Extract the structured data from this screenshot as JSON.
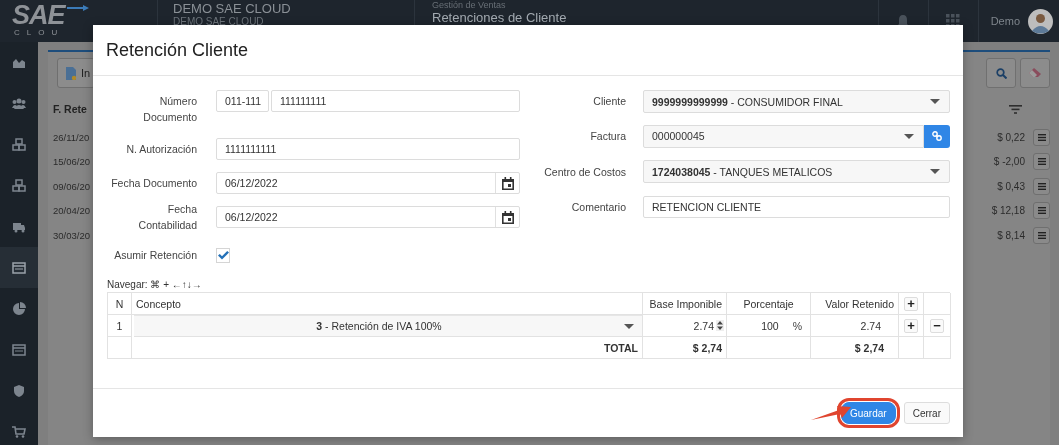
{
  "topbar": {
    "logo": "SAE",
    "logo_sub": "CLOU",
    "company": "DEMO SAE CLOUD",
    "company_sub": "DEMO SAE CLOUD",
    "module": "Gestión de Ventas",
    "page_title": "Retenciones de Cliente",
    "user": "Demo"
  },
  "sidebar": {
    "items": [
      {
        "selected": false
      },
      {
        "selected": false
      },
      {
        "selected": false
      },
      {
        "selected": false
      },
      {
        "selected": false
      },
      {
        "selected": true
      },
      {
        "selected": false
      },
      {
        "selected": false
      },
      {
        "selected": false
      },
      {
        "selected": false
      }
    ]
  },
  "list": {
    "toolbar_button": "In",
    "column_1": "F. Rete",
    "rows": [
      {
        "date": "26/11/20",
        "amount": "$ 0,22"
      },
      {
        "date": "15/06/20",
        "amount": "$ -2,00"
      },
      {
        "date": "09/06/20",
        "amount": "$ 0,43"
      },
      {
        "date": "20/04/20",
        "amount": "$ 12,18"
      },
      {
        "date": "30/03/20",
        "amount": "$ 8,14"
      }
    ]
  },
  "modal": {
    "title": "Retención Cliente",
    "left_fields": [
      {
        "kind": "pair",
        "label": "Número Documento",
        "prefix": "011-111",
        "value": "111111111"
      },
      {
        "kind": "text",
        "label": "N. Autorización",
        "value": "1111111111"
      },
      {
        "kind": "date",
        "label": "Fecha Documento",
        "value": "06/12/2022"
      },
      {
        "kind": "date",
        "label": "Fecha Contabilidad",
        "value": "06/12/2022"
      },
      {
        "kind": "checkbox",
        "label": "Asumir Retención",
        "checked": true
      }
    ],
    "right_fields": [
      {
        "kind": "select",
        "label": "Cliente",
        "value": "**9999999999999** - CONSUMIDOR FINAL"
      },
      {
        "kind": "select_link",
        "label": "Factura",
        "value": "000000045"
      },
      {
        "kind": "select",
        "label": "Centro de Costos",
        "value": "**1724038045** - TANQUES METALICOS"
      },
      {
        "kind": "text",
        "label": "Comentario",
        "value": "RETENCION CLIENTE"
      }
    ],
    "nav_hint": "Navegar: ⌘ + ←↑↓→",
    "table": {
      "columns": [
        "N",
        "Concepto",
        "Base Imponible",
        "Porcentaje",
        "Valor Retenido"
      ],
      "add_button": "+",
      "rows": [
        {
          "n": "1",
          "concepto": "**3** - Retención de IVA 100%",
          "base": "2.74",
          "porcentaje": "100",
          "unit": "%",
          "valor": "2.74",
          "add": "+",
          "remove": "−"
        }
      ],
      "total": {
        "label": "TOTAL",
        "base": "$ 2,74",
        "valor": "$ 2,74"
      }
    },
    "buttons": [
      {
        "label": "Guardar",
        "kind": "primary",
        "highlighted": true
      },
      {
        "label": "Cerrar",
        "kind": "default",
        "highlighted": false
      }
    ]
  }
}
